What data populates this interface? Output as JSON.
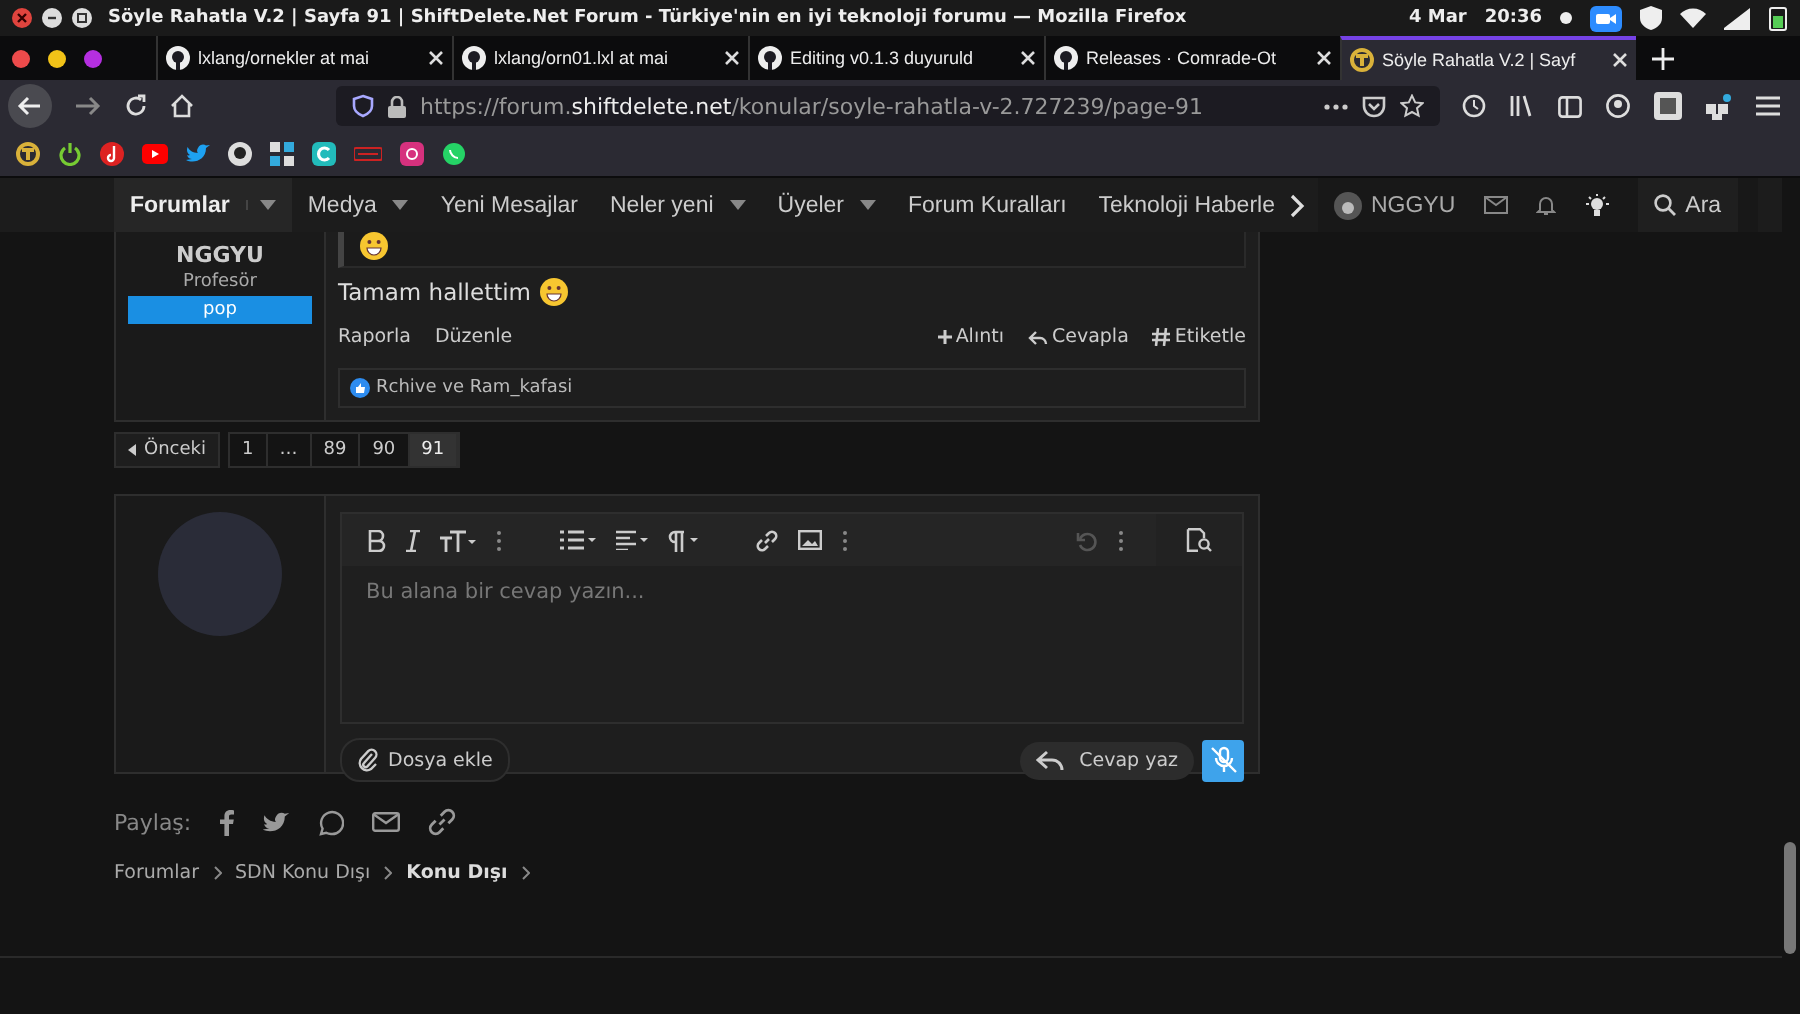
{
  "os_bar": {
    "title": "Söyle Rahatla V.2 | Sayfa 91 | ShiftDelete.Net Forum - Türkiye'nin en iyi teknoloji forumu — Mozilla Firefox",
    "date": "4 Mar",
    "time": "20:36"
  },
  "browser": {
    "tabs": [
      {
        "label": "lxlang/ornekler at mai",
        "selected": false,
        "kind": "github"
      },
      {
        "label": "lxlang/orn01.lxl at mai",
        "selected": false,
        "kind": "github"
      },
      {
        "label": "Editing v0.1.3 duyuruld",
        "selected": false,
        "kind": "github"
      },
      {
        "label": "Releases · Comrade-Ot",
        "selected": false,
        "kind": "github"
      },
      {
        "label": "Söyle Rahatla V.2 | Sayf",
        "selected": true,
        "kind": "site"
      }
    ],
    "url": {
      "prefix": "https://forum.",
      "domain": "shiftdelete.net",
      "path": "/konular/soyle-rahatla-v-2.727239/page-91"
    }
  },
  "forum_nav": {
    "items": [
      {
        "label": "Forumlar",
        "selected": true,
        "dropdown": true
      },
      {
        "label": "Medya",
        "selected": false,
        "dropdown": true
      },
      {
        "label": "Yeni Mesajlar",
        "selected": false,
        "dropdown": false
      },
      {
        "label": "Neler yeni",
        "selected": false,
        "dropdown": true
      },
      {
        "label": "Üyeler",
        "selected": false,
        "dropdown": true
      },
      {
        "label": "Forum Kuralları",
        "selected": false,
        "dropdown": false
      },
      {
        "label": "Teknoloji Haberle",
        "selected": false,
        "dropdown": false
      }
    ],
    "user": "NGGYU",
    "search": "Ara"
  },
  "post": {
    "author": "NGGYU",
    "rank": "Profesör",
    "badge": "pop",
    "message": "Tamam hallettim",
    "actions_left": [
      "Raporla",
      "Düzenle"
    ],
    "actions_right": [
      {
        "kind": "plus",
        "label": "Alıntı"
      },
      {
        "kind": "reply",
        "label": "Cevapla"
      },
      {
        "kind": "hash",
        "label": "Etiketle"
      }
    ],
    "reactions": "Rchive ve Ram_kafasi"
  },
  "pagination": {
    "prev": "Önceki",
    "pages": [
      {
        "label": "1",
        "selected": false
      },
      {
        "label": "…",
        "selected": false
      },
      {
        "label": "89",
        "selected": false
      },
      {
        "label": "90",
        "selected": false
      },
      {
        "label": "91",
        "selected": true
      }
    ]
  },
  "reply": {
    "placeholder": "Bu alana bir cevap yazın...",
    "attach": "Dosya ekle",
    "submit": "Cevap yaz"
  },
  "share": {
    "label": "Paylaş:"
  },
  "breadcrumbs": [
    {
      "label": "Forumlar",
      "current": false
    },
    {
      "label": "SDN Konu Dışı",
      "current": false
    },
    {
      "label": "Konu Dışı",
      "current": true
    }
  ]
}
